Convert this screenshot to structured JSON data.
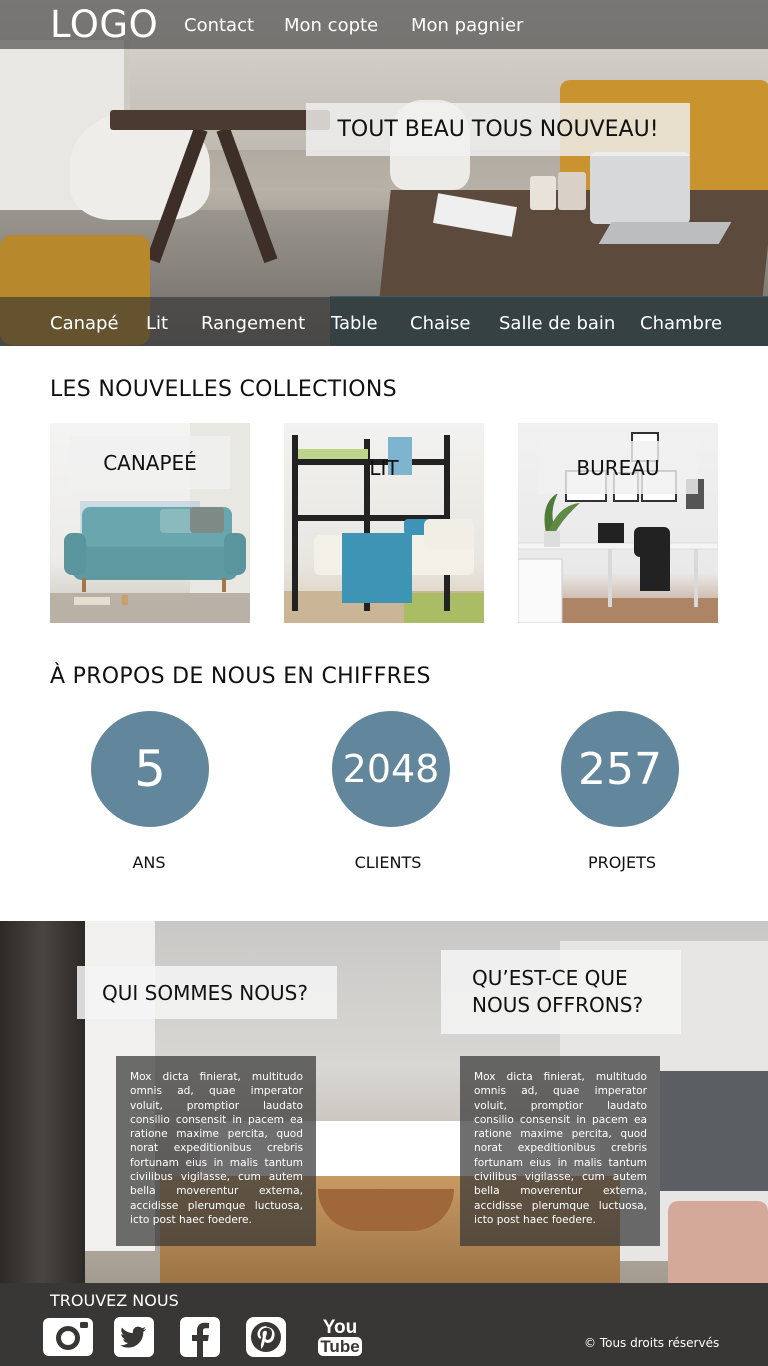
{
  "header": {
    "logo": "LOGO",
    "nav": [
      "Contact",
      "Mon copte",
      "Mon pagnier"
    ]
  },
  "hero": {
    "banner": "TOUT BEAU TOUS NOUVEAU!"
  },
  "categories": [
    "Canapé",
    "Lit",
    "Rangement",
    "Table",
    "Chaise",
    "Salle de bain",
    "Chambre"
  ],
  "collections": {
    "title": "LES NOUVELLES COLLECTIONS",
    "items": [
      {
        "label": "CANAPEÉ"
      },
      {
        "label": "LIT"
      },
      {
        "label": "BUREAU"
      }
    ]
  },
  "stats": {
    "title": "À PROPOS DE NOUS EN CHIFFRES",
    "items": [
      {
        "value": "5",
        "label": "ANS"
      },
      {
        "value": "2048",
        "label": "CLIENTS"
      },
      {
        "value": "257",
        "label": "PROJETS"
      }
    ]
  },
  "about": {
    "who_title": "QUI SOMMES NOUS?",
    "offer_title_line1": "QU’EST-CE QUE",
    "offer_title_line2": "NOUS OFFRONS?",
    "text": "Mox dicta finierat, multitudo omnis ad, quae imperator voluit, promptior laudato consilio consensit in pacem ea ratione maxime percita, quod norat expeditionibus crebris fortunam eius in malis tantum civilibus vigilasse, cum autem bella moverentur externa, accidisse plerumque luctuosa, icto post haec foedere."
  },
  "footer": {
    "title": "TROUVEZ NOUS",
    "social": [
      "instagram-icon",
      "twitter-icon",
      "facebook-icon",
      "pinterest-icon",
      "youtube-icon"
    ],
    "youtube_line1": "You",
    "youtube_line2": "Tube",
    "copyright": "© Tous droits réservés"
  },
  "colors": {
    "stat_circle": "#62869b",
    "footer_bg": "#393735"
  }
}
